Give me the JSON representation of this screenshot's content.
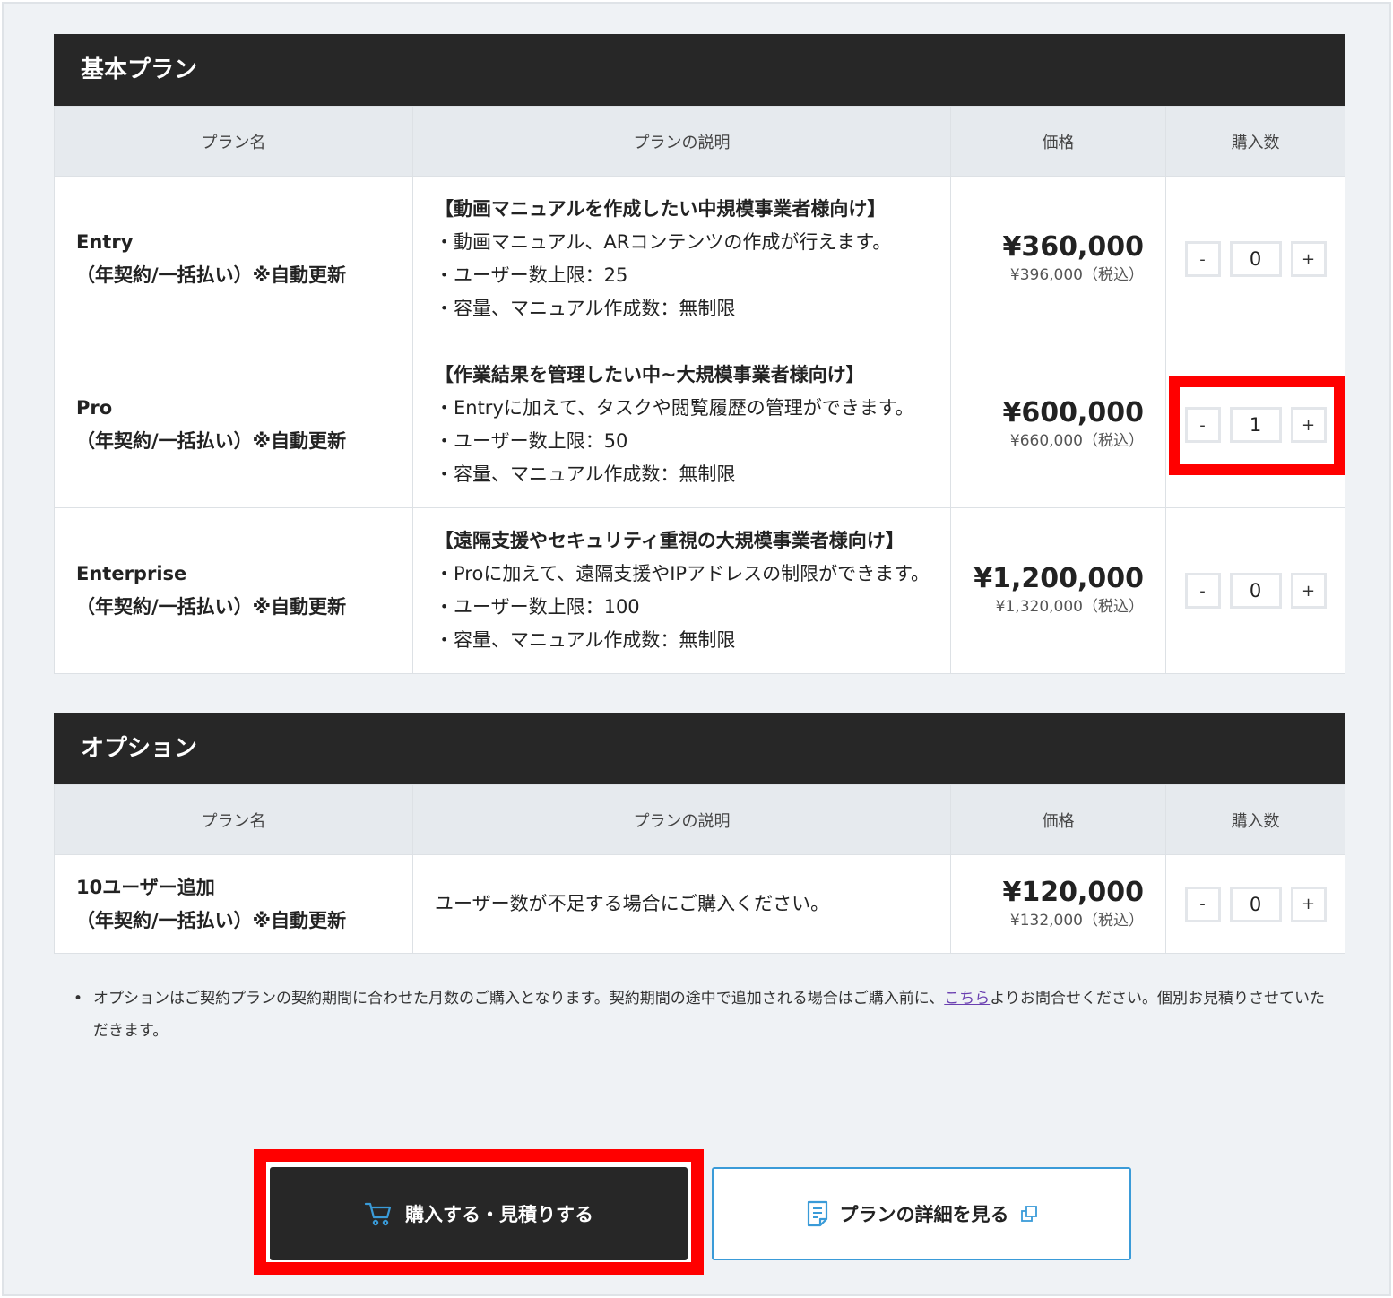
{
  "basic": {
    "title": "基本プラン",
    "headers": [
      "プラン名",
      "プランの説明",
      "価格",
      "購入数"
    ],
    "plans": [
      {
        "name": "Entry",
        "term": "（年契約/一括払い）※自動更新",
        "lead": "【動画マニュアルを作成したい中規模事業者様向け】",
        "lines": [
          "・動画マニュアル、ARコンテンツの作成が行えます。",
          "・ユーザー数上限：25",
          "・容量、マニュアル作成数：無制限"
        ],
        "price": "¥360,000",
        "price_tax": "¥396,000（税込）",
        "qty": "0"
      },
      {
        "name": "Pro",
        "term": "（年契約/一括払い）※自動更新",
        "lead": "【作業結果を管理したい中~大規模事業者様向け】",
        "lines": [
          "・Entryに加えて、タスクや閲覧履歴の管理ができます。",
          "・ユーザー数上限：50",
          "・容量、マニュアル作成数：無制限"
        ],
        "price": "¥600,000",
        "price_tax": "¥660,000（税込）",
        "qty": "1"
      },
      {
        "name": "Enterprise",
        "term": "（年契約/一括払い）※自動更新",
        "lead": "【遠隔支援やセキュリティ重視の大規模事業者様向け】",
        "lines": [
          "・Proに加えて、遠隔支援やIPアドレスの制限ができます。",
          "・ユーザー数上限：100",
          "・容量、マニュアル作成数：無制限"
        ],
        "price": "¥1,200,000",
        "price_tax": "¥1,320,000（税込）",
        "qty": "0"
      }
    ]
  },
  "option": {
    "title": "オプション",
    "headers": [
      "プラン名",
      "プランの説明",
      "価格",
      "購入数"
    ],
    "items": [
      {
        "name": "10ユーザー追加",
        "term": "（年契約/一括払い）※自動更新",
        "desc": "ユーザー数が不足する場合にご購入ください。",
        "price": "¥120,000",
        "price_tax": "¥132,000（税込）",
        "qty": "0"
      }
    ]
  },
  "stepper": {
    "minus": "-",
    "plus": "+"
  },
  "note": {
    "bullet": "•",
    "before": "オプションはご契約プランの契約期間に合わせた月数のご購入となります。契約期間の途中で追加される場合はご購入前に、",
    "link": "こちら",
    "after": "よりお問合せください。個別お見積りさせていただきます。"
  },
  "actions": {
    "buy_label": "購入する・見積りする",
    "detail_label": "プランの詳細を見る"
  },
  "colors": {
    "header_bg": "#272727",
    "highlight": "#ff0000",
    "accent_blue": "#3a9bd8",
    "link": "#6a3fb0"
  },
  "icons": {
    "buy": "cart-icon",
    "detail": "document-icon",
    "external": "external-link-icon"
  }
}
